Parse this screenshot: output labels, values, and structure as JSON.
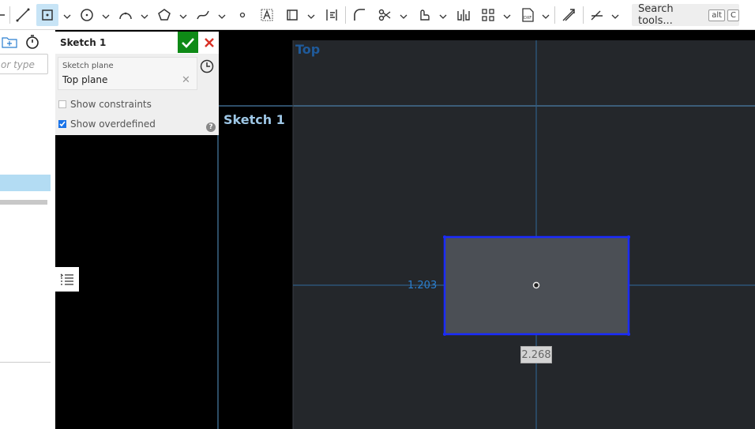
{
  "toolbar": {
    "tools": [
      "line-icon",
      "rectangle-icon",
      "circle-icon",
      "arc-icon",
      "polygon-icon",
      "spline-icon",
      "point-icon",
      "text-icon",
      "construction-icon",
      "dimension-icon",
      "fillet-icon",
      "trim-icon",
      "use-icon",
      "mirror-icon",
      "pattern-icon",
      "dxf-import-icon",
      "offset-icon",
      "constraint-icon"
    ],
    "active_tool": "rectangle-icon",
    "search_label": "Search tools...",
    "search_kbd_1": "alt",
    "search_kbd_2": "C"
  },
  "left_panel": {
    "search_placeholder": "or type"
  },
  "dialog": {
    "title": "Sketch 1",
    "plane_label": "Sketch plane",
    "plane_value": "Top plane",
    "show_constraints": "Show constraints",
    "show_overdefined": "Show overdefined",
    "show_constraints_checked": false,
    "show_overdefined_checked": true
  },
  "viewport": {
    "sketch_label": "Sketch 1",
    "plane_label": "Top",
    "dim_vertical": "1.203",
    "dim_horizontal": "2.268"
  },
  "colors": {
    "accent": "#0e8a16",
    "cancel": "#d93025",
    "sketch_edge": "#1a2bff",
    "plane_fill": "#24272b",
    "axis_line": "#2f5d86"
  }
}
